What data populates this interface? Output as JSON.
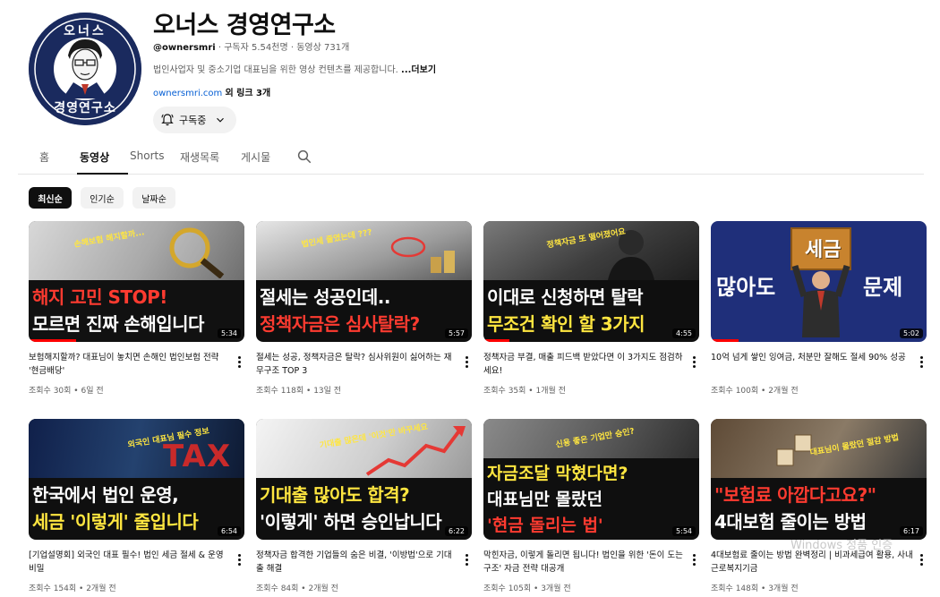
{
  "channel": {
    "name": "오너스 경영연구소",
    "handle": "@ownersmri",
    "subscribers": "구독자 5.54천명",
    "video_count": "동영상 731개",
    "description": "법인사업자 및 중소기업 대표님을 위한 영상 컨텐츠를 제공합니다.",
    "more_label": "...더보기",
    "link": "ownersmri.com",
    "extra_links": "외 링크 3개",
    "subscribe_label": "구독중",
    "avatar_text_top": "오너스",
    "avatar_text_bottom": "경영연구소"
  },
  "tabs": [
    {
      "label": "홈"
    },
    {
      "label": "동영상",
      "active": true
    },
    {
      "label": "Shorts"
    },
    {
      "label": "재생목록"
    },
    {
      "label": "게시물"
    }
  ],
  "chips": [
    {
      "label": "최신순",
      "active": true
    },
    {
      "label": "인기순"
    },
    {
      "label": "날짜순"
    }
  ],
  "videos": [
    {
      "thumb_line1": "해지 고민 STOP!",
      "thumb_line2": "모르면 진짜 손해입니다",
      "thumb_tag": "손해보험 해지할까...",
      "duration": "5:34",
      "title": "보험해지할까? 대표님이 놓치면 손해인 법인보험 전략 '현금배당'",
      "views": "조회수 30회",
      "age": "6일 전",
      "progress": 0.22
    },
    {
      "thumb_line1": "절세는 성공인데..",
      "thumb_line2": "정책자금은 심사탈락?",
      "thumb_tag": "법인세 줄였는데 ???",
      "duration": "5:57",
      "title": "절세는 성공, 정책자금은 탈락? 심사위원이 싫어하는 재무구조 TOP 3",
      "views": "조회수 118회",
      "age": "13일 전",
      "progress": 0.0
    },
    {
      "thumb_line1": "이대로 신청하면 탈락",
      "thumb_line2": "무조건 확인 할 3가지",
      "thumb_tag": "정책자금 또 떨어졌어요",
      "duration": "4:55",
      "title": "정책자금 부결, 매출 피드백 받았다면 이 3가지도 점검하세요!",
      "views": "조회수 35회",
      "age": "1개월 전",
      "progress": 0.12
    },
    {
      "thumb_line1": "많아도",
      "thumb_line2": "문제",
      "thumb_tag": "세금",
      "duration": "5:02",
      "title": "10억 넘게 쌓인 잉여금, 처분만 잘해도 절세 90% 성공",
      "views": "조회수 100회",
      "age": "2개월 전",
      "progress": 0.13
    },
    {
      "thumb_line1": "한국에서 법인 운영,",
      "thumb_line2": "세금 '이렇게' 줄입니다",
      "thumb_tag": "외국인 대표님 필수 정보",
      "duration": "6:54",
      "title": "[기업설명회] 외국인 대표 필수! 법인 세금 절세 & 운영 비밀",
      "views": "조회수 154회",
      "age": "2개월 전",
      "progress": 0.0
    },
    {
      "thumb_line1": "기대출 많아도 합격?",
      "thumb_line2": "'이렇게' 하면 승인납니다",
      "thumb_tag": "기대출 많은데 '이것'만 바꾸세요",
      "duration": "6:22",
      "title": "정책자금 합격한 기업들의 숨은 비결, '이방법'으로 기대출 해결",
      "views": "조회수 84회",
      "age": "2개월 전",
      "progress": 0.0
    },
    {
      "thumb_line1": "자금조달 막혔다면?",
      "thumb_line2": "대표님만 몰랐던",
      "thumb_line3": "'현금 돌리는 법'",
      "thumb_tag": "신용 좋은 기업만 승인?",
      "duration": "5:54",
      "title": "막힌자금, 이렇게 돌리면 됩니다! 법인을 위한 '돈이 도는 구조' 자금 전략 대공개",
      "views": "조회수 105회",
      "age": "3개월 전",
      "progress": 0.0
    },
    {
      "thumb_line1": "\"보험료 아깝다고요?\"",
      "thumb_line2": "4대보험 줄이는 방법",
      "thumb_tag": "대표님이 몰랐던 절감 방법",
      "duration": "6:17",
      "title": "4대보험료 줄이는 방법 완벽정리 | 비과세급여 활용, 사내근로복지기금",
      "views": "조회수 148회",
      "age": "3개월 전",
      "progress": 0.0
    }
  ],
  "colors": {
    "avatar_bg": "#1a2a5e",
    "red_text": "#ff3b30",
    "yellow_text": "#ffe640",
    "white_text": "#ffffff"
  },
  "watermark": "Windows 정품 인증"
}
